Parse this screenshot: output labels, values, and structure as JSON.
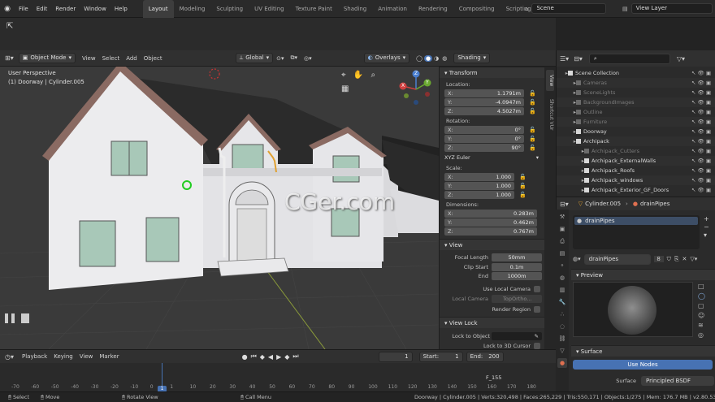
{
  "menus": [
    "File",
    "Edit",
    "Render",
    "Window",
    "Help"
  ],
  "workspaces": [
    "Layout",
    "Modeling",
    "Sculpting",
    "UV Editing",
    "Texture Paint",
    "Shading",
    "Animation",
    "Rendering",
    "Compositing",
    "Scripting"
  ],
  "active_workspace": "Layout",
  "add_workspace": "+",
  "scene_name": "Scene",
  "view_layer": "View Layer",
  "viewport": {
    "mode": "Object Mode",
    "header_menus": [
      "View",
      "Select",
      "Add",
      "Object"
    ],
    "transform_orientation": "Global",
    "overlays": "Overlays",
    "shading": "Shading",
    "info_line1": "User Perspective",
    "info_line2": "(1) Doorway | Cylinder.005",
    "gizmo": {
      "z": "Z",
      "y": "Y",
      "x": "X"
    },
    "watermark": "CGer.com"
  },
  "npanel": {
    "tabs": [
      "View",
      "Shortcut VUr"
    ],
    "transform": {
      "title": "Transform",
      "location_label": "Location:",
      "location": {
        "x": "1.1791m",
        "y": "-4.0947m",
        "z": "4.5027m"
      },
      "rotation_label": "Rotation:",
      "rotation": {
        "x": "0°",
        "y": "0°",
        "z": "90°"
      },
      "rotation_mode": "XYZ Euler",
      "scale_label": "Scale:",
      "scale": {
        "x": "1.000",
        "y": "1.000",
        "z": "1.000"
      },
      "dimensions_label": "Dimensions:",
      "dimensions": {
        "x": "0.283m",
        "y": "0.462m",
        "z": "0.767m"
      }
    },
    "view": {
      "title": "View",
      "focal_length_label": "Focal Length",
      "focal_length": "50mm",
      "clip_start_label": "Clip Start",
      "clip_start": "0.1m",
      "end_label": "End",
      "end": "1000m",
      "use_local_camera": "Use Local Camera",
      "local_camera_label": "Local Camera",
      "local_camera": "TopOrtho...",
      "render_region": "Render Region"
    },
    "view_lock": {
      "title": "View Lock",
      "lock_to_object": "Lock to Object",
      "lock_to_cursor": "Lock to 3D Cursor"
    },
    "axis": {
      "x": "X:",
      "y": "Y:",
      "z": "Z:"
    }
  },
  "outliner": {
    "rows": [
      {
        "label": "Scene Collection",
        "dim": false,
        "indent": 0
      },
      {
        "label": "Cameras",
        "dim": true,
        "indent": 1
      },
      {
        "label": "SceneLights",
        "dim": true,
        "indent": 1
      },
      {
        "label": "BackgroundImages",
        "dim": true,
        "indent": 1
      },
      {
        "label": "Outline",
        "dim": true,
        "indent": 1
      },
      {
        "label": "Furniture",
        "dim": true,
        "indent": 1
      },
      {
        "label": "Doorway",
        "dim": false,
        "indent": 1
      },
      {
        "label": "Archipack",
        "dim": false,
        "indent": 1
      },
      {
        "label": "Archipack_Cutters",
        "dim": true,
        "indent": 2
      },
      {
        "label": "Archipack_ExternalWalls",
        "dim": false,
        "indent": 2
      },
      {
        "label": "Archipack_Roofs",
        "dim": false,
        "indent": 2
      },
      {
        "label": "Archipack_windows",
        "dim": false,
        "indent": 2
      },
      {
        "label": "Archipack_Exterior_GF_Doors",
        "dim": false,
        "indent": 2
      }
    ]
  },
  "properties": {
    "object_name": "Cylinder.005",
    "material_name": "drainPipes",
    "slot_name": "drainPipes",
    "material_field": "drainPipes",
    "user_count": "8",
    "preview_title": "Preview",
    "surface_title": "Surface",
    "use_nodes": "Use Nodes",
    "surface_label": "Surface",
    "surface_value": "Principled BSDF"
  },
  "timeline": {
    "menus": [
      "Playback",
      "Keying",
      "View",
      "Marker"
    ],
    "current_frame": "1",
    "start_label": "Start:",
    "start": "1",
    "end_label": "End:",
    "end": "200",
    "marker": "F_155",
    "ticks": [
      "-70",
      "-60",
      "-50",
      "-40",
      "-30",
      "-20",
      "-10",
      "0",
      "1",
      "10",
      "20",
      "30",
      "40",
      "50",
      "60",
      "70",
      "80",
      "90",
      "100",
      "110",
      "120",
      "130",
      "140",
      "150",
      "160",
      "170",
      "180"
    ]
  },
  "statusbar": {
    "select": "Select",
    "move": "Move",
    "rotate": "Rotate View",
    "call_menu": "Call Menu",
    "info": "Doorway | Cylinder.005 | Verts:320,498 | Faces:265,229 | Tris:550,171 | Objects:1/275 | Mem: 176.7 MB | v2.80.53"
  },
  "colors": {
    "accent": "#4772b3",
    "active_tab": "#3d3d3d",
    "highlight": "#e0a030"
  }
}
